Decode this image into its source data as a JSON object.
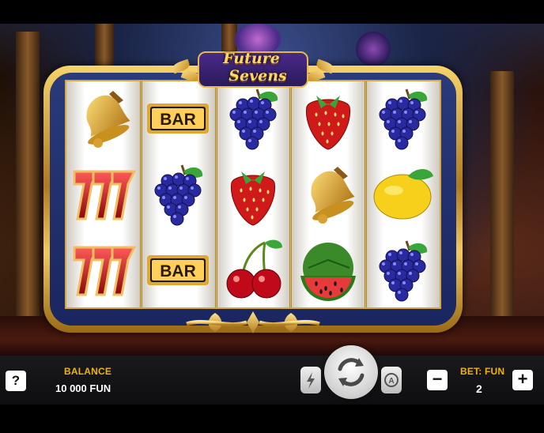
{
  "game": {
    "logo_line1": "Future",
    "logo_line2": "Sevens",
    "grid": [
      [
        "bell",
        "bar",
        "grapes",
        "strawberry",
        "grapes"
      ],
      [
        "seven",
        "grapes",
        "strawberry",
        "bell",
        "lemon"
      ],
      [
        "seven",
        "bar",
        "cherries",
        "watermelon",
        "grapes"
      ]
    ],
    "bar_text": "BAR"
  },
  "controls": {
    "help_label": "?",
    "balance_label": "BALANCE",
    "balance_value": "10 000 FUN",
    "bet_label": "BET: FUN",
    "bet_value": "2",
    "minus_label": "−",
    "plus_label": "+",
    "turbo_icon": "lightning-icon",
    "spin_icon": "spin-arrows-icon",
    "autoplay_icon": "autoplay-icon"
  },
  "colors": {
    "accent": "#f2b400",
    "frame_gold": "#d8a840",
    "frame_blue": "#1a2660"
  }
}
